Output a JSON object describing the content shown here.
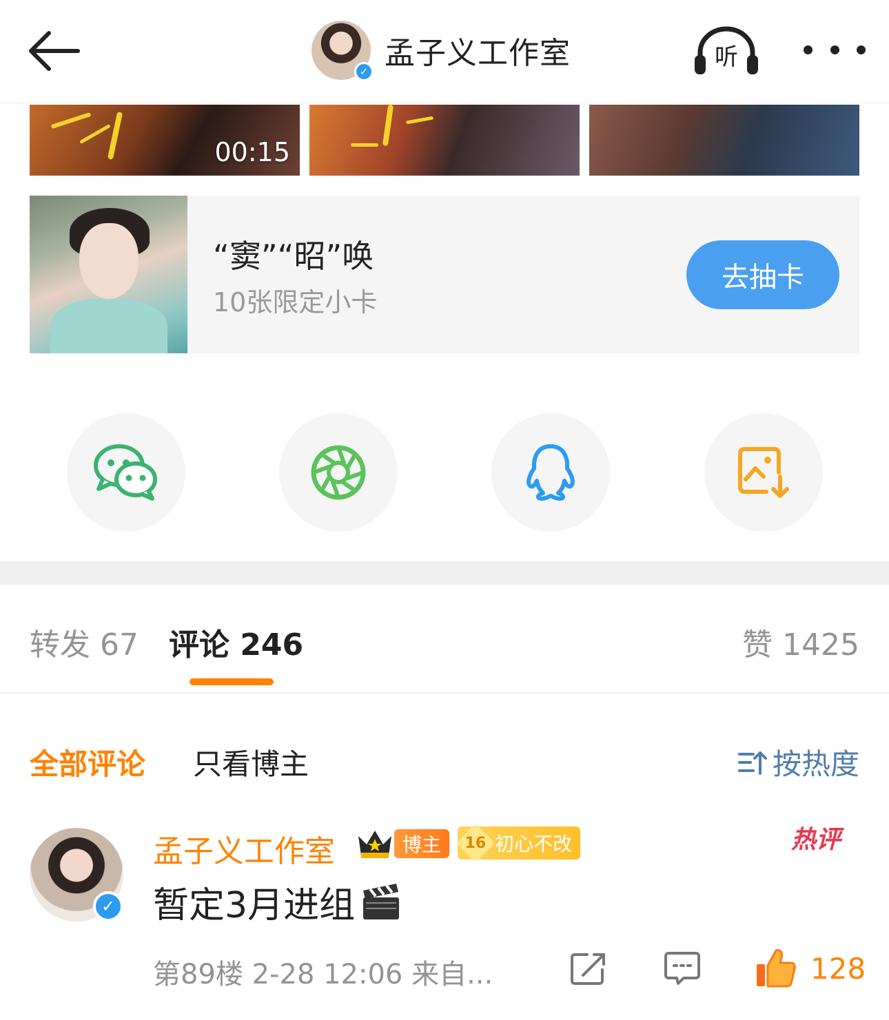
{
  "header": {
    "title": "孟子义工作室",
    "listen_label": "听",
    "verify_mark": "✓"
  },
  "video_thumbs": {
    "duration": "00:15"
  },
  "promo_card": {
    "title": "“窦”“昭”唤",
    "subtitle": "10张限定小卡",
    "button_label": "去抽卡"
  },
  "share_targets": [
    "wechat-icon",
    "moments-icon",
    "qq-icon",
    "save-image-icon"
  ],
  "tabs": {
    "repost": "转发 67",
    "comments": "评论 246",
    "likes": "赞 1425"
  },
  "filters": {
    "all": "全部评论",
    "blogger_only": "只看博主",
    "sort": "按热度"
  },
  "comment": {
    "author": "孟子义工作室",
    "verify_mark": "✓",
    "badge_blogger": "博主",
    "badge_level": "16",
    "badge_loyal": "初心不改",
    "hot_label": "热评",
    "text": "暂定3月进组",
    "meta": "第89楼  2-28 12:06  来自...",
    "like_count": "128"
  },
  "colors": {
    "accent": "#ff8200",
    "link": "#507daf",
    "button_blue": "#4a9ff0",
    "wechat_green": "#3cb371",
    "qq_blue": "#2d9cf0",
    "save_orange": "#f5a623",
    "hot_red": "#e8384f"
  }
}
